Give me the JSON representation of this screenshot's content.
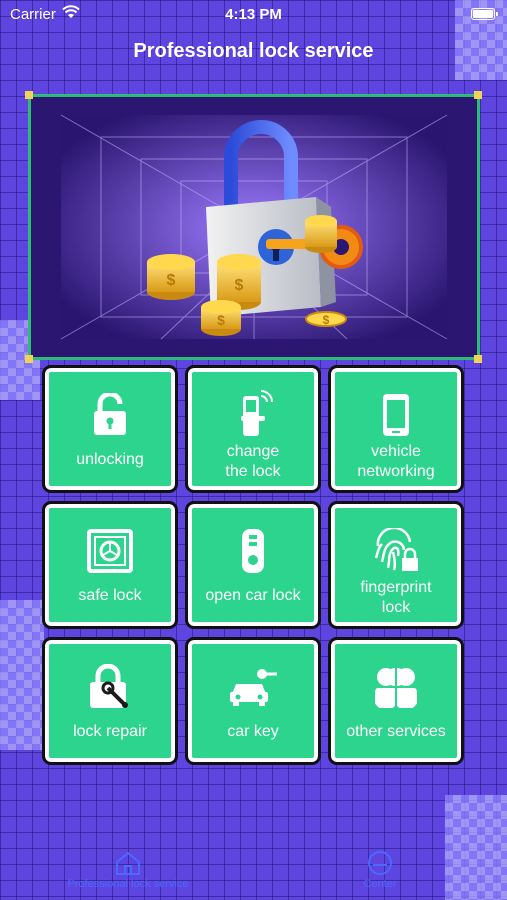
{
  "status_bar": {
    "carrier": "Carrier",
    "time": "4:13 PM"
  },
  "header": {
    "title": "Professional lock service"
  },
  "services": [
    {
      "label": "unlocking",
      "icon": "padlock-open-icon"
    },
    {
      "label": "change\nthe lock",
      "icon": "smart-lock-icon"
    },
    {
      "label": "vehicle\nnetworking",
      "icon": "phone-icon"
    },
    {
      "label": "safe lock",
      "icon": "safe-icon"
    },
    {
      "label": "open car lock",
      "icon": "remote-key-icon"
    },
    {
      "label": "fingerprint\nlock",
      "icon": "fingerprint-lock-icon"
    },
    {
      "label": "lock repair",
      "icon": "lock-wrench-icon"
    },
    {
      "label": "car key",
      "icon": "car-key-icon"
    },
    {
      "label": "other services",
      "icon": "clover-icon"
    }
  ],
  "tabbar": {
    "tabs": [
      {
        "label": "Professional lock service",
        "icon": "home-icon"
      },
      {
        "label": "Center",
        "icon": "person-icon"
      }
    ]
  },
  "colors": {
    "background": "#5f45e0",
    "tile": "#2cd48e",
    "accent": "#4b68ff"
  }
}
